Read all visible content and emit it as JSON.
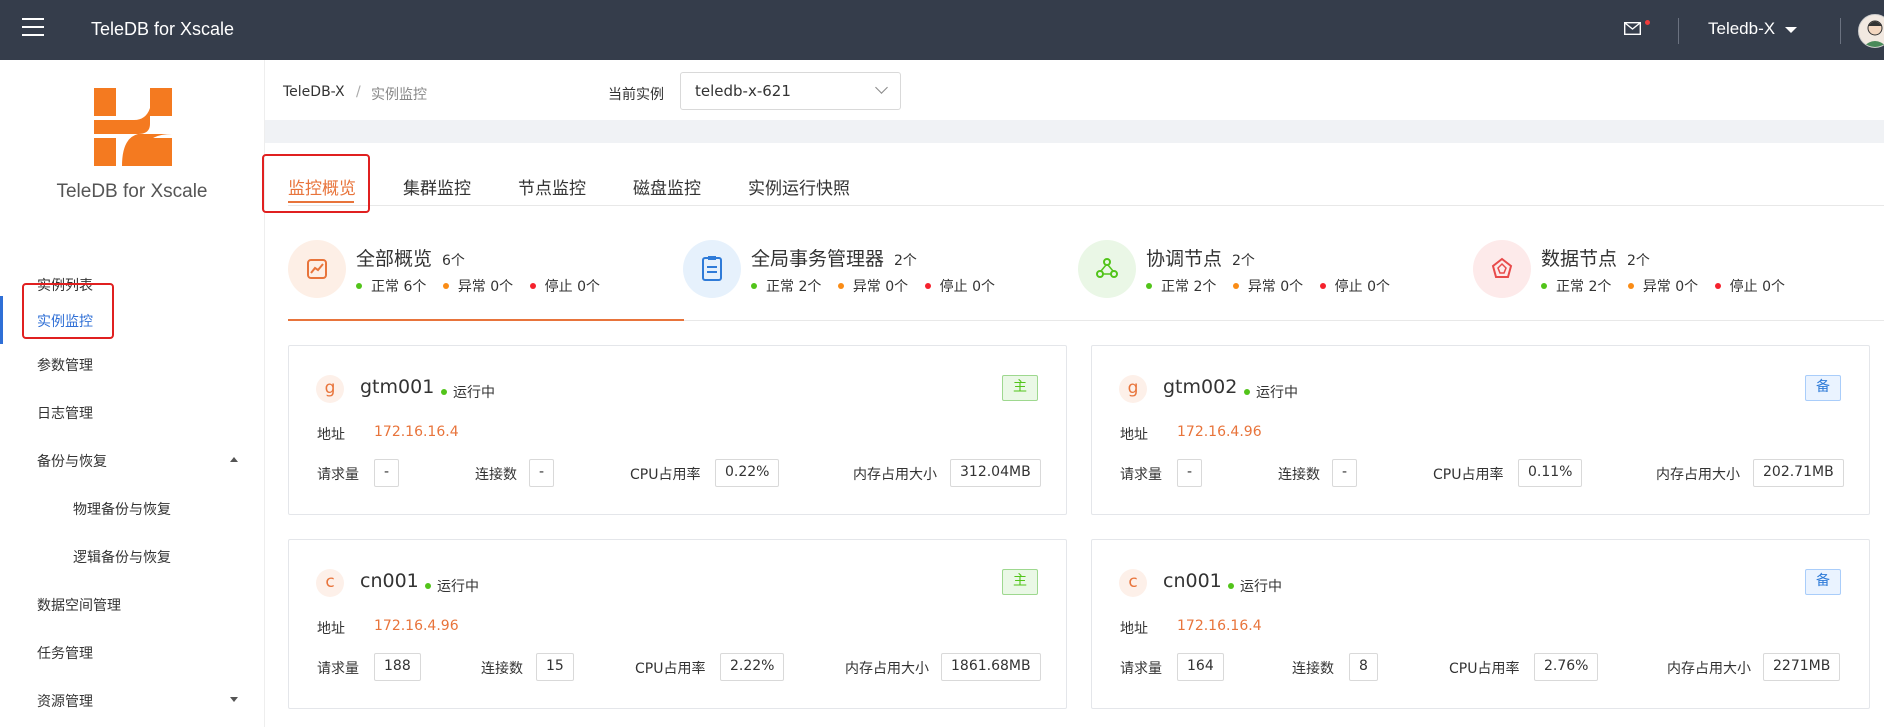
{
  "header": {
    "app_title": "TeleDB for Xscale",
    "user": "Teledb-X"
  },
  "sidebar": {
    "logo_text": "TeleDB for Xscale",
    "items": [
      {
        "label": "实例列表"
      },
      {
        "label": "实例监控",
        "active": true
      },
      {
        "label": "参数管理"
      },
      {
        "label": "日志管理"
      },
      {
        "label": "备份与恢复",
        "expanded": true
      },
      {
        "label": "物理备份与恢复"
      },
      {
        "label": "逻辑备份与恢复"
      },
      {
        "label": "数据空间管理"
      },
      {
        "label": "任务管理"
      },
      {
        "label": "资源管理",
        "expanded": false
      }
    ]
  },
  "breadcrumb": {
    "root": "TeleDB-X",
    "separator": "/",
    "current": "实例监控"
  },
  "instance_select": {
    "label": "当前实例",
    "value": "teledb-x-621"
  },
  "tabs": [
    {
      "label": "监控概览",
      "active": true
    },
    {
      "label": "集群监控"
    },
    {
      "label": "节点监控"
    },
    {
      "label": "磁盘监控"
    },
    {
      "label": "实例运行快照"
    }
  ],
  "summary": [
    {
      "title": "全部概览",
      "count": "6个",
      "normal": "正常 6个",
      "abnormal": "异常 0个",
      "stopped": "停止 0个",
      "icon": "chart-icon",
      "active": true
    },
    {
      "title": "全局事务管理器",
      "count": "2个",
      "normal": "正常 2个",
      "abnormal": "异常 0个",
      "stopped": "停止 0个",
      "icon": "clipboard-icon"
    },
    {
      "title": "协调节点",
      "count": "2个",
      "normal": "正常 2个",
      "abnormal": "异常 0个",
      "stopped": "停止 0个",
      "icon": "nodes-icon"
    },
    {
      "title": "数据节点",
      "count": "2个",
      "normal": "正常 2个",
      "abnormal": "异常 0个",
      "stopped": "停止 0个",
      "icon": "pentagon-icon"
    }
  ],
  "labels": {
    "address": "地址",
    "requests": "请求量",
    "connections": "连接数",
    "cpu": "CPU占用率",
    "memory": "内存占用大小"
  },
  "cards": [
    {
      "badge": "g",
      "name": "gtm001",
      "status": "运行中",
      "role": "主",
      "address": "172.16.16.4",
      "requests": "-",
      "connections": "-",
      "cpu": "0.22%",
      "memory": "312.04MB"
    },
    {
      "badge": "g",
      "name": "gtm002",
      "status": "运行中",
      "role": "备",
      "address": "172.16.4.96",
      "requests": "-",
      "connections": "-",
      "cpu": "0.11%",
      "memory": "202.71MB"
    },
    {
      "badge": "c",
      "name": "cn001",
      "status": "运行中",
      "role": "主",
      "address": "172.16.4.96",
      "requests": "188",
      "connections": "15",
      "cpu": "2.22%",
      "memory": "1861.68MB"
    },
    {
      "badge": "c",
      "name": "cn001",
      "status": "运行中",
      "role": "备",
      "address": "172.16.16.4",
      "requests": "164",
      "connections": "8",
      "cpu": "2.76%",
      "memory": "2271MB"
    }
  ],
  "colors": {
    "accent": "#e8743b",
    "normal": "#52c41a",
    "abnormal": "#fa8c16",
    "stopped": "#f5222d",
    "active_menu": "#2f6fd6",
    "header_bg": "#353d4b"
  }
}
